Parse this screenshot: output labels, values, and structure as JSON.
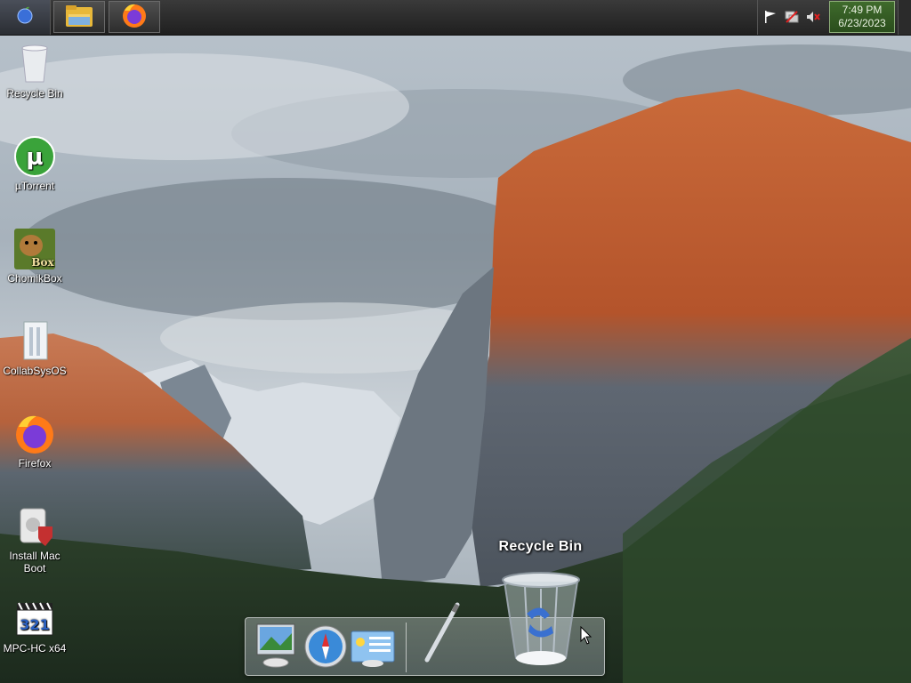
{
  "taskbar": {
    "start_icon": "apple-logo-icon",
    "tasks": [
      {
        "name": "file-explorer-task",
        "icon": "folder-icon"
      },
      {
        "name": "firefox-task",
        "icon": "firefox-icon"
      }
    ],
    "tray": {
      "icons": [
        "flag-icon",
        "network-icon",
        "volume-muted-icon"
      ],
      "time": "7:49 PM",
      "date": "6/23/2023"
    }
  },
  "desktop": {
    "icons": [
      {
        "label": "Recycle Bin",
        "icon": "recycle-bin-icon"
      },
      {
        "label": "µTorrent",
        "icon": "utorrent-icon"
      },
      {
        "label": "ChomikBox",
        "icon": "chomikbox-icon",
        "badge": "Box"
      },
      {
        "label": "CollabSysOS",
        "icon": "collabsysos-icon"
      },
      {
        "label": "Firefox",
        "icon": "firefox-icon"
      },
      {
        "label": "Install Mac Boot",
        "icon": "installer-icon"
      },
      {
        "label": "MPC-HC x64",
        "icon": "mpc-hc-icon",
        "badge": "321"
      }
    ]
  },
  "dock": {
    "tooltip": "Recycle Bin",
    "items": [
      "preview-icon",
      "safari-icon",
      "dashboard-icon",
      "pen-icon",
      "trash-icon"
    ]
  },
  "colors": {
    "taskbar": "#2a2a2a",
    "clock_bg": "#3a6228",
    "utorrent": "#3aa33a",
    "firefox_orange": "#ff7a18",
    "firefox_purple": "#7b3bd8"
  }
}
